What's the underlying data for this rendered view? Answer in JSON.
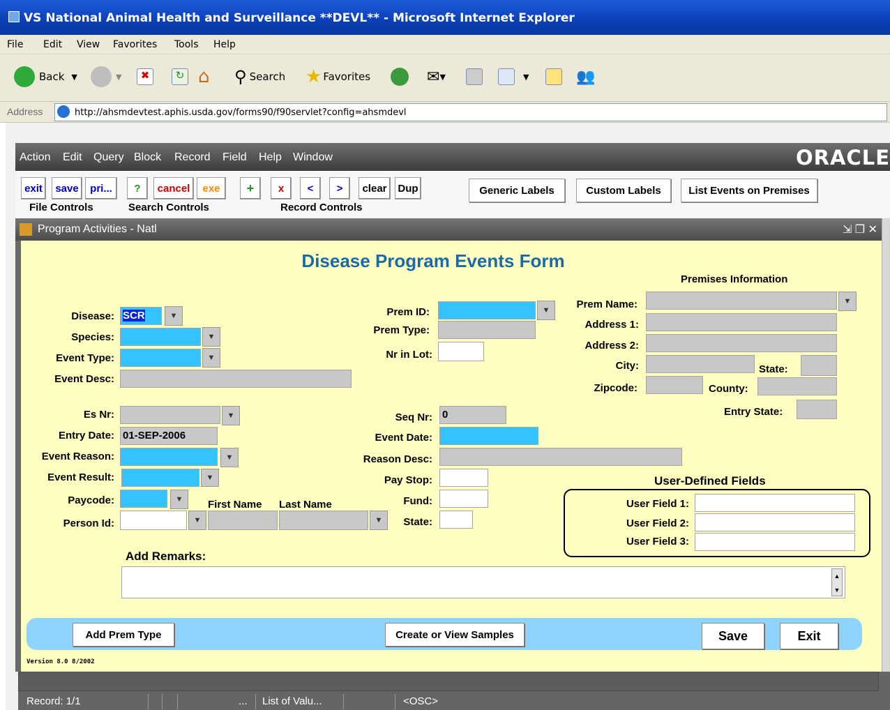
{
  "window": {
    "title": "VS National Animal Health and Surveillance **DEVL** - Microsoft Internet Explorer"
  },
  "ie_menu": [
    "File",
    "Edit",
    "View",
    "Favorites",
    "Tools",
    "Help"
  ],
  "ie_toolbar": {
    "back": "Back",
    "search": "Search",
    "favorites": "Favorites"
  },
  "address": {
    "label": "Address",
    "url": "http://ahsmdevtest.aphis.usda.gov/forms90/f90servlet?config=ahsmdevl"
  },
  "oracle_menu": [
    "Action",
    "Edit",
    "Query",
    "Block",
    "Record",
    "Field",
    "Help",
    "Window"
  ],
  "oracle_logo": "ORACLE",
  "form_toolbar": {
    "exit": "exit",
    "save": "save",
    "print": "pri...",
    "help": "?",
    "cancel": "cancel",
    "exe": "exe",
    "add": "+",
    "delete": "x",
    "prev": "<",
    "next": ">",
    "clear": "clear",
    "dup": "Dup",
    "file_controls": "File Controls",
    "search_controls": "Search Controls",
    "record_controls": "Record Controls",
    "generic_labels": "Generic Labels",
    "custom_labels": "Custom Labels",
    "list_events": "List Events on Premises"
  },
  "subwindow": {
    "title": "Program Activities - Natl"
  },
  "form": {
    "title": "Disease Program Events Form",
    "premises_heading": "Premises Information",
    "disease_label": "Disease:",
    "disease_value": "SCR",
    "species_label": "Species:",
    "event_type_label": "Event Type:",
    "event_desc_label": "Event Desc:",
    "es_nr_label": "Es Nr:",
    "entry_date_label": "Entry Date:",
    "entry_date_value": "01-SEP-2006",
    "event_reason_label": "Event Reason:",
    "event_result_label": "Event Result:",
    "paycode_label": "Paycode:",
    "person_id_label": "Person Id:",
    "first_name_label": "First Name",
    "last_name_label": "Last Name",
    "prem_id_label": "Prem ID:",
    "prem_type_label": "Prem Type:",
    "nr_in_lot_label": "Nr in Lot:",
    "seq_nr_label": "Seq Nr:",
    "seq_nr_value": "0",
    "event_date_label": "Event Date:",
    "reason_desc_label": "Reason Desc:",
    "pay_stop_label": "Pay Stop:",
    "fund_label": "Fund:",
    "state_label": "State:",
    "prem_name_label": "Prem Name:",
    "address1_label": "Address 1:",
    "address2_label": "Address 2:",
    "city_label": "City:",
    "prem_state_label": "State:",
    "zipcode_label": "Zipcode:",
    "county_label": "County:",
    "entry_state_label": "Entry State:",
    "udf_heading": "User-Defined Fields",
    "user_field1_label": "User Field 1:",
    "user_field2_label": "User Field 2:",
    "user_field3_label": "User Field 3:",
    "add_remarks_label": "Add Remarks:",
    "add_prem_type": "Add Prem Type",
    "create_samples": "Create or View Samples",
    "save": "Save",
    "exit": "Exit",
    "version": "Version 8.0 8/2002"
  },
  "status": {
    "record": "Record: 1/1",
    "dots": "...",
    "lov": "List of Valu...",
    "osc": "<OSC>"
  }
}
